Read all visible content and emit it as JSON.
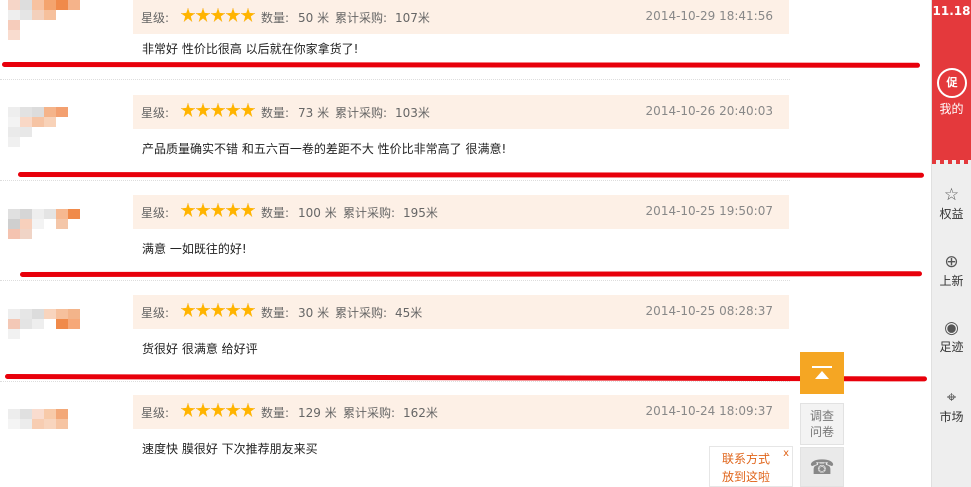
{
  "meta_labels": {
    "rating": "星级:",
    "quantity_prefix": "数量:",
    "total_prefix": "累计采购:"
  },
  "reviews": [
    {
      "quantity": "50 米",
      "total": "107米",
      "date": "2014-10-29 18:41:56",
      "content": "非常好 性价比很高 以后就在你家拿货了!",
      "stars": 5
    },
    {
      "quantity": "73 米",
      "total": "103米",
      "date": "2014-10-26 20:40:03",
      "content": "产品质量确实不错 和五六百一卷的差距不大 性价比非常高了 很满意!",
      "stars": 5
    },
    {
      "quantity": "100 米",
      "total": "195米",
      "date": "2014-10-25 19:50:07",
      "content": "满意 一如既往的好!",
      "stars": 5
    },
    {
      "quantity": "30 米",
      "total": "45米",
      "date": "2014-10-25 08:28:37",
      "content": "货很好 很满意 给好评",
      "stars": 5
    },
    {
      "quantity": "129 米",
      "total": "162米",
      "date": "2014-10-24 18:09:37",
      "content": "速度快 膜很好 下次推荐朋友来买",
      "stars": 5
    }
  ],
  "sidebar": {
    "logo": "11.18",
    "badge": "促",
    "my": "我的",
    "items": [
      "权益",
      "上新",
      "足迹",
      "市场"
    ]
  },
  "widgets": {
    "survey_line1": "调查",
    "survey_line2": "问卷",
    "contact_line1": "联系方式",
    "contact_line2": "放到这啦",
    "contact_close": "x"
  },
  "colors": {
    "accent_red": "#e4393c",
    "meta_bg": "#fdf0e6",
    "backtop": "#f5a623",
    "annotation_red": "#e8000b"
  }
}
